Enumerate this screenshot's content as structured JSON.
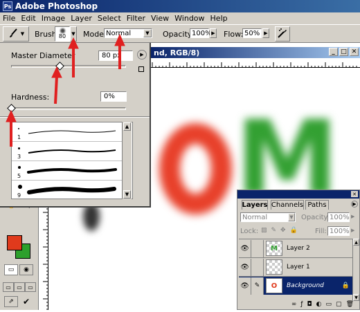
{
  "app": {
    "title": "Adobe Photoshop"
  },
  "menu": [
    "File",
    "Edit",
    "Image",
    "Layer",
    "Select",
    "Filter",
    "View",
    "Window",
    "Help"
  ],
  "options": {
    "brush_label": "Brush:",
    "brush_size": "80",
    "mode_label": "Mode:",
    "mode_value": "Normal",
    "opacity_label": "Opacity:",
    "opacity_value": "100%",
    "flow_label": "Flow:",
    "flow_value": "50%"
  },
  "brush_popup": {
    "diameter_label": "Master Diameter",
    "diameter_value": "80 px",
    "diameter_fraction": 0.42,
    "hardness_label": "Hardness:",
    "hardness_value": "0%",
    "hardness_fraction": 0.0,
    "presets": [
      {
        "size": "1"
      },
      {
        "size": "3"
      },
      {
        "size": "5"
      },
      {
        "size": "9"
      }
    ]
  },
  "document": {
    "title_fragment": "nd, RGB/8)"
  },
  "canvas_letters": {
    "o": "O",
    "m": "M"
  },
  "layers_panel": {
    "tabs": [
      "Layers",
      "Channels",
      "Paths"
    ],
    "blend_mode": "Normal",
    "opacity_label": "Opacity:",
    "opacity_value": "100%",
    "lock_label": "Lock:",
    "fill_label": "Fill:",
    "fill_value": "100%",
    "layers": [
      {
        "name": "Layer 2",
        "thumb": "M"
      },
      {
        "name": "Layer 1",
        "thumb": ""
      },
      {
        "name": "Background",
        "thumb": "O"
      }
    ]
  },
  "colors": {
    "foreground": "#e03a1c",
    "background": "#2ca02c",
    "annotation_arrows": "#e02020"
  }
}
